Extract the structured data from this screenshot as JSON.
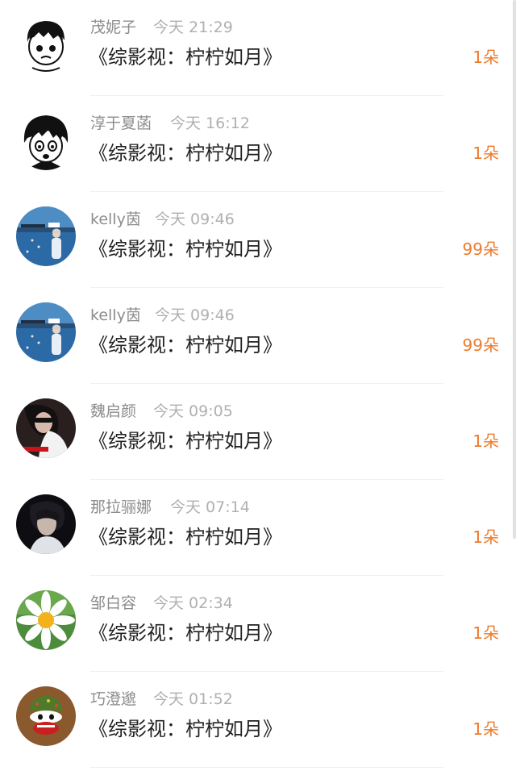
{
  "rows": [
    {
      "name": "茂妮子",
      "time": "今天 21:29",
      "title": "《综影视：柠柠如月》",
      "count": "1朵",
      "avatar": "manga-boy-avatar"
    },
    {
      "name": "淳于夏菡",
      "time": "今天 16:12",
      "title": "《综影视：柠柠如月》",
      "count": "1朵",
      "avatar": "manga-boy-avatar"
    },
    {
      "name": "kelly茵",
      "time": "今天 09:46",
      "title": "《综影视：柠柠如月》",
      "count": "99朵",
      "avatar": "sea-photo-avatar"
    },
    {
      "name": "kelly茵",
      "time": "今天 09:46",
      "title": "《综影视：柠柠如月》",
      "count": "99朵",
      "avatar": "sea-photo-avatar"
    },
    {
      "name": "魏启颜",
      "time": "今天 09:05",
      "title": "《综影视：柠柠如月》",
      "count": "1朵",
      "avatar": "portrait-photo-avatar"
    },
    {
      "name": "那拉骊娜",
      "time": "今天 07:14",
      "title": "《综影视：柠柠如月》",
      "count": "1朵",
      "avatar": "portrait-photo-avatar"
    },
    {
      "name": "邹白容",
      "time": "今天 02:34",
      "title": "《综影视：柠柠如月》",
      "count": "1朵",
      "avatar": "daisy-avatar"
    },
    {
      "name": "巧澄邈",
      "time": "今天 01:52",
      "title": "《综影视：柠柠如月》",
      "count": "1朵",
      "avatar": "cartoon-monkey-avatar"
    }
  ],
  "colors": {
    "count": "#ee7b2c",
    "name": "#8c8c8c",
    "time": "#b0b0b0",
    "title": "#222222"
  }
}
